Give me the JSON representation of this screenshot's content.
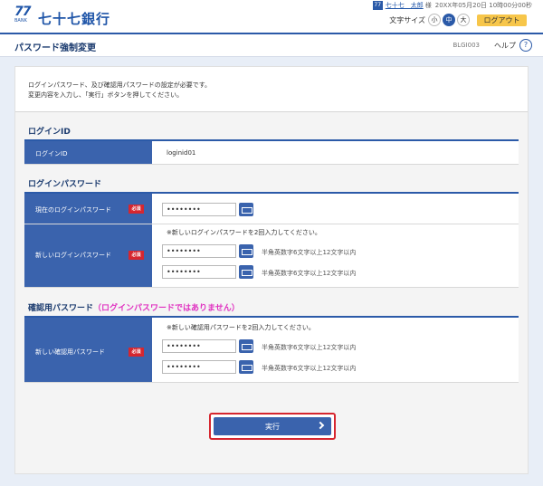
{
  "header": {
    "bank_name": "七十七銀行",
    "logo_mark": "77",
    "logo_sub": "BANK",
    "user_icon": "person-badge-icon",
    "user_icon_glyph": "77",
    "user_name": "七十七　太郎",
    "user_honorific": "様",
    "last_login": "20XX年05月20日 10時00分00秒",
    "text_size_label": "文字サイズ",
    "size_small": "小",
    "size_medium": "中",
    "size_large": "大",
    "logout_label": "ログアウト"
  },
  "titlebar": {
    "title": "パスワード強制変更",
    "screen_id": "BLGI003",
    "help_label": "ヘルプ",
    "help_icon": "?"
  },
  "notice": {
    "line1": "ログインパスワード、及び確認用パスワードの設定が必要です。",
    "line2": "変更内容を入力し、「実行」ボタンを押してください。"
  },
  "login_id_section": {
    "title": "ログインID",
    "label": "ログインID",
    "value": "loginid01"
  },
  "login_password_section": {
    "title": "ログインパスワード",
    "current_label": "現在のログインパスワード",
    "current_value": "••••••••",
    "new_label": "新しいログインパスワード",
    "new_note": "※新しいログインパスワードを2回入力してください。",
    "new_value_1": "••••••••",
    "new_value_2": "••••••••",
    "hint": "半角英数字6文字以上12文字以内",
    "required": "必須"
  },
  "confirm_password_section": {
    "title": "確認用パスワード",
    "title_note": "（ログインパスワードではありません）",
    "label": "新しい確認用パスワード",
    "note": "※新しい確認用パスワードを2回入力してください。",
    "value_1": "••••••••",
    "value_2": "••••••••",
    "hint": "半角英数字6文字以上12文字以内",
    "required": "必須"
  },
  "execute": {
    "label": "実行"
  },
  "colors": {
    "brand_blue": "#2b5aa8",
    "label_blue": "#3a63ad",
    "required_red": "#d6262f",
    "logout_yellow": "#f7c64a",
    "highlight_pink": "#e030c0"
  }
}
